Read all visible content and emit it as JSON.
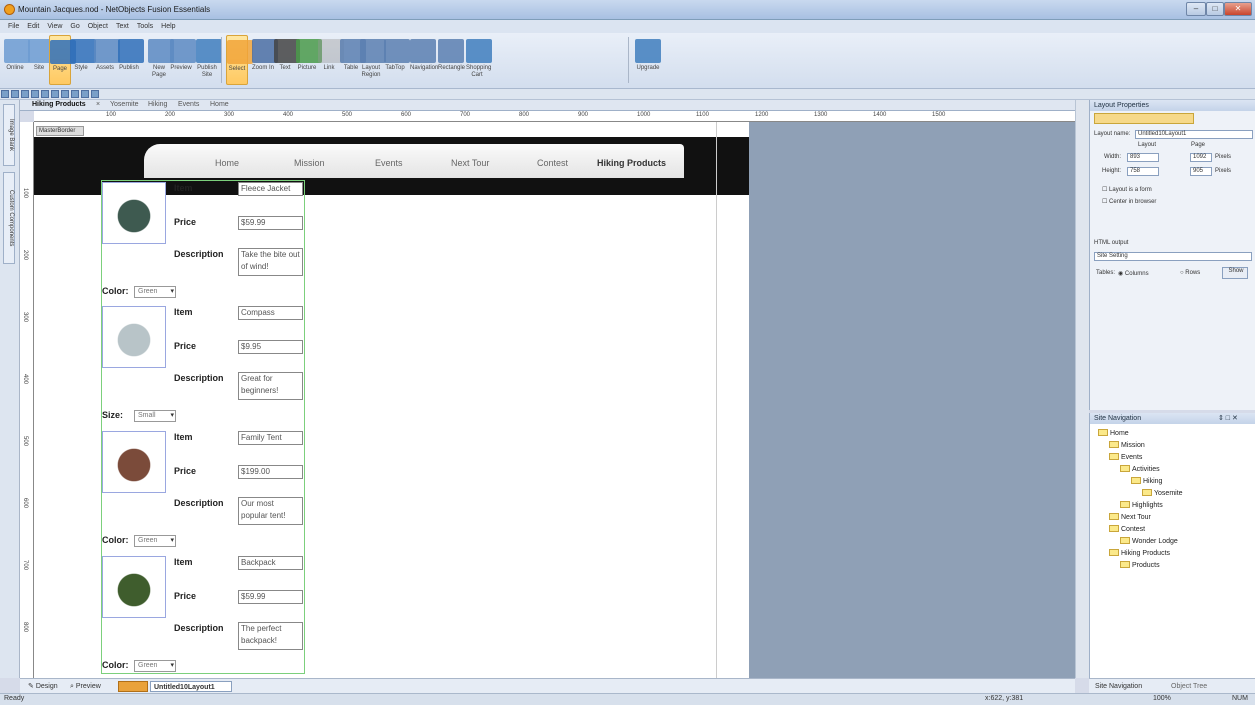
{
  "window": {
    "title": "Mountain Jacques.nod - NetObjects Fusion Essentials",
    "minimize": "–",
    "maximize": "□",
    "close": "✕"
  },
  "menu": [
    "File",
    "Edit",
    "View",
    "Go",
    "Object",
    "Text",
    "Tools",
    "Help"
  ],
  "ribbon": [
    {
      "label": "Online",
      "icon": "monitor-icon"
    },
    {
      "label": "Site",
      "icon": "site-icon"
    },
    {
      "label": "Page",
      "icon": "page-icon",
      "active": true
    },
    {
      "label": "Style",
      "icon": "style-brush-icon"
    },
    {
      "label": "Assets",
      "icon": "assets-icon"
    },
    {
      "label": "Publish",
      "icon": "publish-cloud-icon"
    },
    {
      "label": "New Page",
      "icon": "new-page-icon"
    },
    {
      "label": "Preview",
      "icon": "preview-icon"
    },
    {
      "label": "Publish Site",
      "icon": "publish-site-icon"
    },
    {
      "label": "Select",
      "icon": "arrow-cursor-icon",
      "active": true
    },
    {
      "label": "Zoom In",
      "icon": "zoom-icon"
    },
    {
      "label": "Text",
      "icon": "text-T-icon"
    },
    {
      "label": "Picture",
      "icon": "picture-icon"
    },
    {
      "label": "Link",
      "icon": "link-icon"
    },
    {
      "label": "Table",
      "icon": "table-icon"
    },
    {
      "label": "Layout Region",
      "icon": "layout-region-icon"
    },
    {
      "label": "TabTop",
      "icon": "tabtop-icon"
    },
    {
      "label": "Navigation",
      "icon": "navigation-icon"
    },
    {
      "label": "Rectangle",
      "icon": "rectangle-icon"
    },
    {
      "label": "Shopping Cart",
      "icon": "cart-icon"
    },
    {
      "label": "Upgrade",
      "icon": "upgrade-icon"
    }
  ],
  "doc_tabs": [
    "Hiking Products",
    "×",
    "Yosemite",
    "Hiking",
    "Events",
    "Home"
  ],
  "ruler_labels": [
    "100",
    "200",
    "300",
    "400",
    "500",
    "600",
    "700",
    "800",
    "900",
    "1000",
    "1100",
    "1200",
    "1300",
    "1400",
    "1500"
  ],
  "side_tabs": [
    "Image Bank",
    "Custom Components"
  ],
  "masterborder_label": "MasterBorder",
  "nav_links": [
    "Home",
    "Mission",
    "Events",
    "Next Tour",
    "Contest",
    "Hiking Products"
  ],
  "products": [
    {
      "item": "Fleece Jacket",
      "price": "$59.99",
      "desc": "Take the bite out of wind!",
      "option_label": "Color:",
      "option_value": "Green",
      "image": "fleece-jacket-image"
    },
    {
      "item": "Compass",
      "price": "$9.95",
      "desc": "Great for beginners!",
      "option_label": "Size:",
      "option_value": "Small",
      "image": "compass-image"
    },
    {
      "item": "Family Tent",
      "price": "$199.00",
      "desc": "Our most popular tent!",
      "option_label": "Color:",
      "option_value": "Green",
      "image": "tent-image"
    },
    {
      "item": "Backpack",
      "price": "$59.99",
      "desc": "The perfect backpack!",
      "option_label": "Color:",
      "option_value": "Green",
      "image": "backpack-image"
    }
  ],
  "field_labels": {
    "item": "Item",
    "price": "Price",
    "desc": "Description"
  },
  "layout_properties": {
    "title": "Layout Properties",
    "layout_name_label": "Layout name:",
    "layout_name": "Untitled10Layout1",
    "col_layout": "Layout",
    "col_page": "Page",
    "width_label": "Width:",
    "width_layout": "893",
    "width_page": "1092",
    "height_label": "Height:",
    "height_layout": "758",
    "height_page": "905",
    "unit": "Pixels",
    "layout_form": "Layout is a form",
    "center_browser": "Center in browser",
    "html_output_label": "HTML output",
    "html_output_value": "Site Setting",
    "tables_label": "Tables:",
    "columns": "Columns",
    "rows": "Rows",
    "show": "Show"
  },
  "site_navigation": {
    "title": "Site Navigation",
    "controls": "⇕ □ ✕",
    "tree": [
      {
        "label": "Home",
        "level": 0
      },
      {
        "label": "Mission",
        "level": 1
      },
      {
        "label": "Events",
        "level": 1
      },
      {
        "label": "Activities",
        "level": 2
      },
      {
        "label": "Hiking",
        "level": 3
      },
      {
        "label": "Yosemite",
        "level": 4
      },
      {
        "label": "Highlights",
        "level": 2
      },
      {
        "label": "Next Tour",
        "level": 1
      },
      {
        "label": "Contest",
        "level": 1
      },
      {
        "label": "Wonder Lodge",
        "level": 2
      },
      {
        "label": "Hiking Products",
        "level": 1
      },
      {
        "label": "Products",
        "level": 2
      }
    ],
    "bottom_tabs": [
      "Site Navigation",
      "Object Tree"
    ]
  },
  "bottom_tabs": {
    "design": "Design",
    "preview": "Preview",
    "layout": "Untitled10Layout1"
  },
  "status": {
    "left": "Ready",
    "coords": "x:622, y:381",
    "zoom": "100%",
    "num": "NUM"
  }
}
